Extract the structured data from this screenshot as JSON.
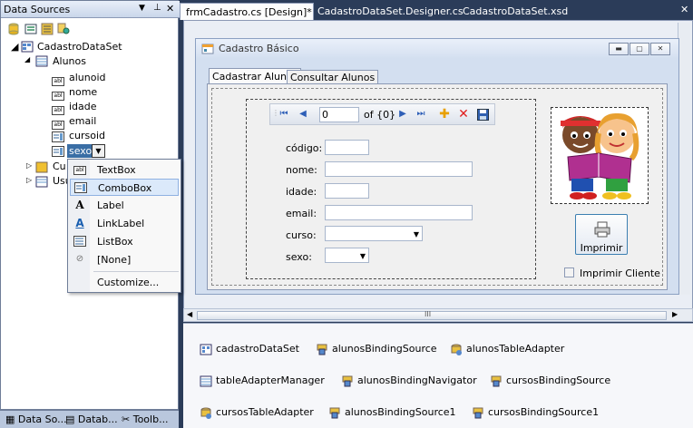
{
  "data_sources_panel": {
    "title": "Data Sources",
    "tree": {
      "dataset": "CadastroDataSet",
      "table": "Alunos",
      "fields": [
        {
          "icon": "abl",
          "name": "alunoid"
        },
        {
          "icon": "abl",
          "name": "nome"
        },
        {
          "icon": "abl",
          "name": "idade"
        },
        {
          "icon": "abl",
          "name": "email"
        },
        {
          "icon": "grid",
          "name": "cursoid"
        },
        {
          "icon": "grid",
          "name": "sexo"
        }
      ],
      "partial_items": [
        "Cu",
        "Usu"
      ]
    },
    "bottom_tabs": [
      "Data So...",
      "Datab...",
      "Toolb..."
    ]
  },
  "dropdown_menu": {
    "items": [
      "TextBox",
      "ComboBox",
      "Label",
      "LinkLabel",
      "ListBox",
      "[None]"
    ],
    "selected": "ComboBox",
    "customize": "Customize..."
  },
  "doc_tabs": [
    "frmCadastro.cs [Design]*",
    "CadastroDataSet.Designer.cs",
    "CadastroDataSet.xsd"
  ],
  "form": {
    "title": "Cadastro Básico",
    "tabs": [
      "Cadastrar Alunos",
      "Consultar Alunos"
    ],
    "navigator": {
      "position": "0",
      "count": "of {0}"
    },
    "fields": [
      "código:",
      "nome:",
      "idade:",
      "email:",
      "curso:",
      "sexo:"
    ],
    "print_button": "Imprimir",
    "checkbox_label": "Imprimir Cliente"
  },
  "scroll_label": "III",
  "component_tray": [
    "cadastroDataSet",
    "alunosBindingSource",
    "alunosTableAdapter",
    "tableAdapterManager",
    "alunosBindingNavigator",
    "cursosBindingSource",
    "cursosTableAdapter",
    "alunosBindingSource1",
    "cursosBindingSource1"
  ]
}
